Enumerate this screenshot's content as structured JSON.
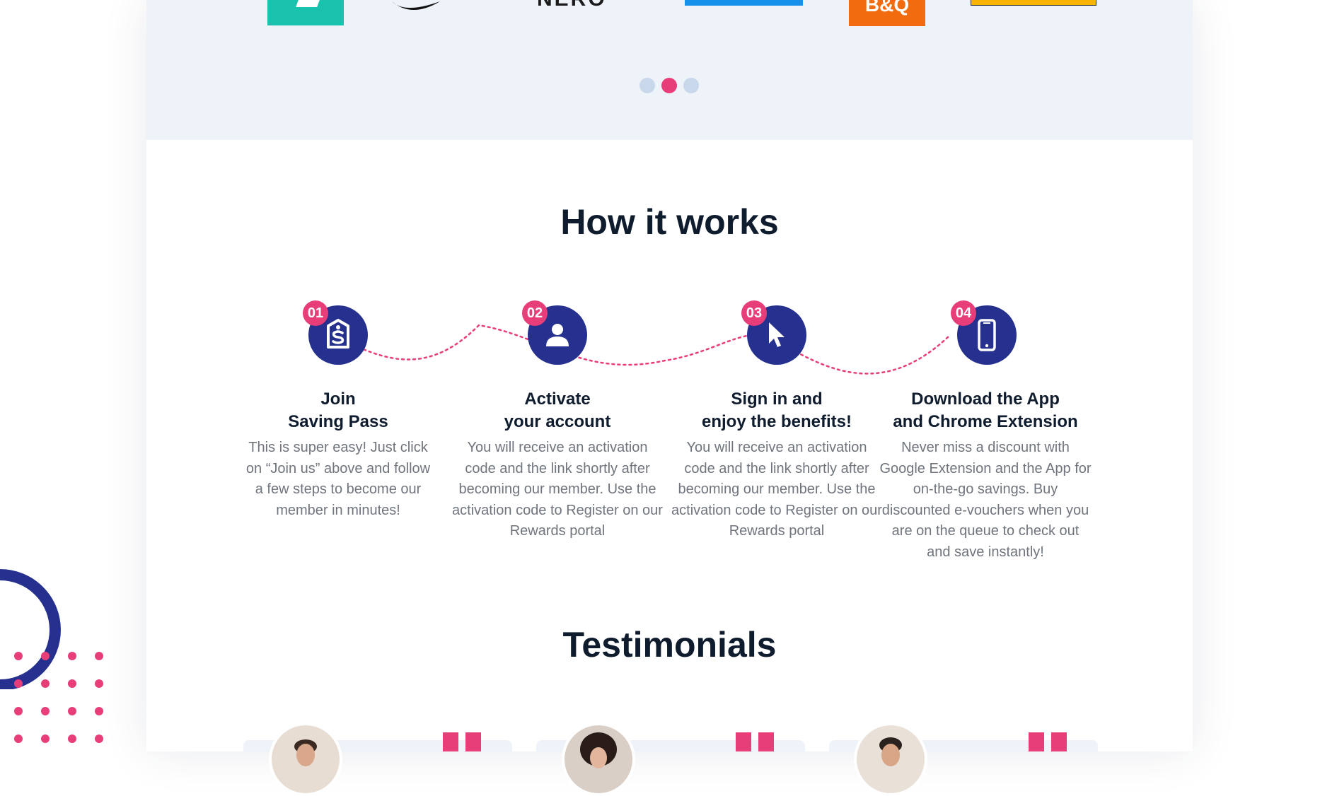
{
  "brands": {
    "logo_3_text": "NERO",
    "logo_5_text": "B&Q"
  },
  "carousel": {
    "dot_count": 3,
    "active_index": 1
  },
  "how_it_works": {
    "title": "How it works",
    "steps": [
      {
        "number": "01",
        "icon": "shield-lock-icon",
        "title": "Join\nSaving Pass",
        "description": "This is super easy! Just click on “Join us” above and follow a few steps to become our member in minutes!"
      },
      {
        "number": "02",
        "icon": "user-icon",
        "title": "Activate\nyour account",
        "description": "You will receive an activation code and the link shortly after becoming our member. Use the activation code to Register on our Rewards portal"
      },
      {
        "number": "03",
        "icon": "cursor-icon",
        "title": "Sign in and\nenjoy the benefits!",
        "description": "You will receive an activation code and the link shortly after becoming our member. Use the activation code to Register on our Rewards portal"
      },
      {
        "number": "04",
        "icon": "smartphone-icon",
        "title": "Download the App\nand Chrome Extension",
        "description": "Never miss a discount with Google Extension and the App for on-the-go savings. Buy discounted e-vouchers when you are on the queue to check out and save instantly!"
      }
    ]
  },
  "testimonials": {
    "title": "Testimonials"
  },
  "colors": {
    "accent_pink": "#e73e7a",
    "brand_navy": "#25308f",
    "band_bg": "#eef2f9",
    "heading": "#0f1c2e",
    "body_text": "#6f747d"
  }
}
